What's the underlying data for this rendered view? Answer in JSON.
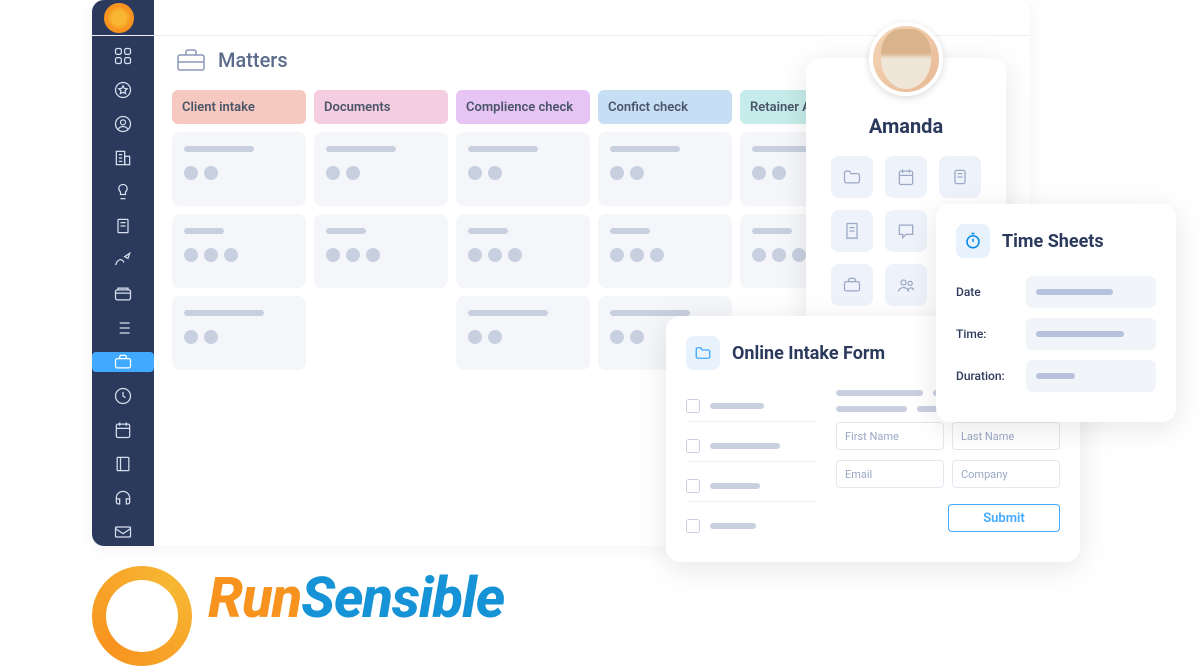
{
  "page": {
    "title": "Matters"
  },
  "columns": [
    {
      "label": "Client intake",
      "color": "#f6c9c0",
      "cards": 3
    },
    {
      "label": "Documents",
      "color": "#f4cde0",
      "cards": 2
    },
    {
      "label": "Complience check",
      "color": "#e6c5f4",
      "cards": 3
    },
    {
      "label": "Confict check",
      "color": "#c7dff4",
      "cards": 3
    },
    {
      "label": "Retainer Ag",
      "color": "#c5ecea",
      "cards": 2
    }
  ],
  "contact": {
    "name": "Amanda"
  },
  "intake": {
    "title": "Online Intake Form",
    "fields": {
      "first_name": "First Name",
      "last_name": "Last Name",
      "email": "Email",
      "company": "Company"
    },
    "submit": "Submit"
  },
  "timesheets": {
    "title": "Time Sheets",
    "labels": {
      "date": "Date",
      "time": "Time:",
      "duration": "Duration:"
    }
  },
  "brand": {
    "part1": "Run",
    "part2": "Sensible"
  }
}
